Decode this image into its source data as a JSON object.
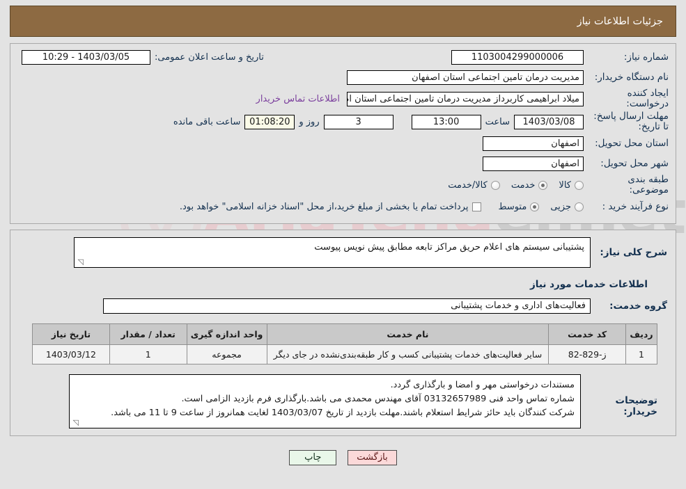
{
  "header": {
    "title": "جزئیات اطلاعات نیاز"
  },
  "watermark": {
    "brand_a": "AriaTend",
    "brand_b": "er.net"
  },
  "form": {
    "need_number_label": "شماره نیاز:",
    "need_number_value": "1103004299000006",
    "public_announce_label": "تاریخ و ساعت اعلان عمومی:",
    "public_announce_value": "1403/03/05 - 10:29",
    "buyer_org_label": "نام دستگاه خریدار:",
    "buyer_org_value": "مدیریت درمان تامین اجتماعی استان اصفهان",
    "creator_label": "ایجاد کننده درخواست:",
    "creator_value": "میلاد ابراهیمی کاربرداز مدیریت درمان تامین اجتماعی استان اصفهان",
    "buyer_contact_link": "اطلاعات تماس خریدار",
    "deadline_label": "مهلت ارسال پاسخ: تا تاریخ:",
    "deadline_date": "1403/03/08",
    "hour_label": "ساعت",
    "deadline_time": "13:00",
    "days_value": "3",
    "days_label": "روز و",
    "countdown_value": "01:08:20",
    "remaining_label": "ساعت باقی مانده",
    "delivery_province_label": "استان محل تحویل:",
    "delivery_province_value": "اصفهان",
    "delivery_city_label": "شهر محل تحویل:",
    "delivery_city_value": "اصفهان",
    "category_label": "طبقه بندی موضوعی:",
    "category_options": [
      {
        "label": "کالا",
        "selected": false
      },
      {
        "label": "خدمت",
        "selected": true
      },
      {
        "label": "کالا/خدمت",
        "selected": false
      }
    ],
    "process_label": "نوع فرآیند خرید :",
    "process_options": [
      {
        "label": "جزیی",
        "selected": false
      },
      {
        "label": "متوسط",
        "selected": true
      }
    ],
    "treasury_note": "پرداخت تمام یا بخشی از مبلغ خرید،از محل \"اسناد خزانه اسلامی\" خواهد بود."
  },
  "description": {
    "label": "شرح کلی نیاز:",
    "value": "پشتیبانی سیستم های اعلام حریق مراکز تابعه مطابق پیش نویس پیوست"
  },
  "services_section": {
    "title": "اطلاعات خدمات مورد نیاز",
    "group_label": "گروه خدمت:",
    "group_value": "فعالیت‌های اداری و خدمات پشتیبانی"
  },
  "table": {
    "headers": [
      "ردیف",
      "کد خدمت",
      "نام خدمت",
      "واحد اندازه گیری",
      "تعداد / مقدار",
      "تاریخ نیاز"
    ],
    "rows": [
      {
        "radif": "1",
        "code": "ز-829-82",
        "name": "سایر فعالیت‌های خدمات پشتیبانی کسب و کار طبقه‌بندی‌نشده در جای دیگر",
        "unit": "مجموعه",
        "qty": "1",
        "date": "1403/03/12"
      }
    ]
  },
  "notes": {
    "label": "توضیحات خریدار:",
    "line1": "مستندات درخواستی مهر و امضا و بارگذاری گردد.",
    "line2": "شماره تماس واحد فنی 03132657989 آقای مهندس محمدی می باشد.بارگذاری فرم بازدید الزامی است.",
    "line3": "شرکت کنندگان باید حائز شرایط استعلام باشند.مهلت بازدید از تاریخ 1403/03/07 لغایت همانروز از ساعت 9 تا 11 می باشد."
  },
  "footer": {
    "print_label": "چاپ",
    "back_label": "بازگشت"
  },
  "colors": {
    "header_bg": "#8d6a42",
    "page_bg": "#e3e3e3",
    "label_text": "#13304f",
    "link": "#7b3f9d",
    "table_header_bg": "#c9c9c9",
    "print_btn_bg": "#e9f7e9",
    "back_btn_bg": "#fbd9d9",
    "countdown_bg": "#fbfbe8"
  }
}
